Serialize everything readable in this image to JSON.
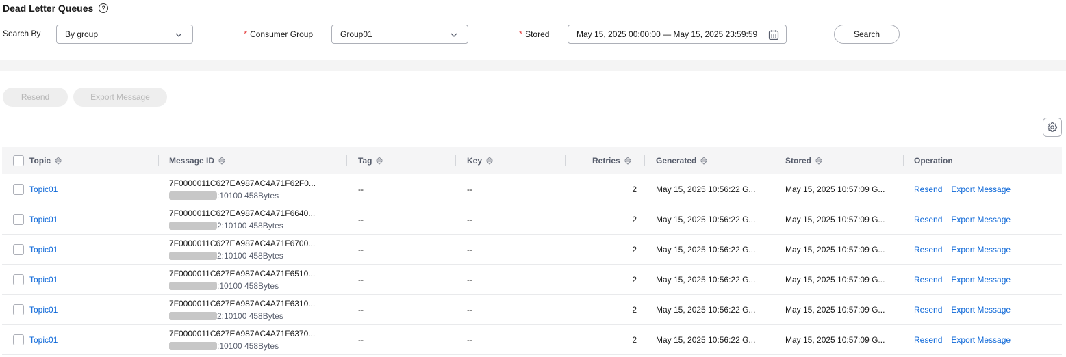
{
  "page": {
    "title": "Dead Letter Queues"
  },
  "filters": {
    "search_by_label": "Search By",
    "search_by_value": "By group",
    "required_mark": "*",
    "consumer_group_label": "Consumer Group",
    "consumer_group_value": "Group01",
    "stored_label": "Stored",
    "stored_range": "May 15, 2025 00:00:00 — May 15, 2025 23:59:59",
    "search_button": "Search"
  },
  "toolbar": {
    "resend": "Resend",
    "export": "Export Message"
  },
  "table": {
    "headers": {
      "topic": "Topic",
      "message_id": "Message ID",
      "tag": "Tag",
      "key": "Key",
      "retries": "Retries",
      "generated": "Generated",
      "stored": "Stored",
      "operation": "Operation"
    },
    "rows": [
      {
        "topic": "Topic01",
        "id": "7F0000011C627EA987AC4A71F62F0...",
        "addr": ":10100 458Bytes",
        "tag": "--",
        "key": "--",
        "retries": "2",
        "generated": "May 15, 2025 10:56:22 G...",
        "stored": "May 15, 2025 10:57:09 G...",
        "op_resend": "Resend",
        "op_export": "Export Message"
      },
      {
        "topic": "Topic01",
        "id": "7F0000011C627EA987AC4A71F6640...",
        "addr": "2:10100 458Bytes",
        "tag": "--",
        "key": "--",
        "retries": "2",
        "generated": "May 15, 2025 10:56:22 G...",
        "stored": "May 15, 2025 10:57:09 G...",
        "op_resend": "Resend",
        "op_export": "Export Message"
      },
      {
        "topic": "Topic01",
        "id": "7F0000011C627EA987AC4A71F6700...",
        "addr": "2:10100 458Bytes",
        "tag": "--",
        "key": "--",
        "retries": "2",
        "generated": "May 15, 2025 10:56:22 G...",
        "stored": "May 15, 2025 10:57:09 G...",
        "op_resend": "Resend",
        "op_export": "Export Message"
      },
      {
        "topic": "Topic01",
        "id": "7F0000011C627EA987AC4A71F6510...",
        "addr": ":10100 458Bytes",
        "tag": "--",
        "key": "--",
        "retries": "2",
        "generated": "May 15, 2025 10:56:22 G...",
        "stored": "May 15, 2025 10:57:09 G...",
        "op_resend": "Resend",
        "op_export": "Export Message"
      },
      {
        "topic": "Topic01",
        "id": "7F0000011C627EA987AC4A71F6310...",
        "addr": "2:10100 458Bytes",
        "tag": "--",
        "key": "--",
        "retries": "2",
        "generated": "May 15, 2025 10:56:22 G...",
        "stored": "May 15, 2025 10:57:09 G...",
        "op_resend": "Resend",
        "op_export": "Export Message"
      },
      {
        "topic": "Topic01",
        "id": "7F0000011C627EA987AC4A71F6370...",
        "addr": ":10100 458Bytes",
        "tag": "--",
        "key": "--",
        "retries": "2",
        "generated": "May 15, 2025 10:56:22 G...",
        "stored": "May 15, 2025 10:57:09 G...",
        "op_resend": "Resend",
        "op_export": "Export Message"
      }
    ]
  },
  "icons": {
    "help": "question-circle-icon",
    "chevron": "chevron-down-icon",
    "calendar": "calendar-icon",
    "settings": "gear-icon",
    "sort": "sort-icon"
  },
  "colors": {
    "link": "#0c67d8",
    "required": "#e54545",
    "disabled_bg": "#eeeeee",
    "header_bg": "#f5f5f6"
  }
}
